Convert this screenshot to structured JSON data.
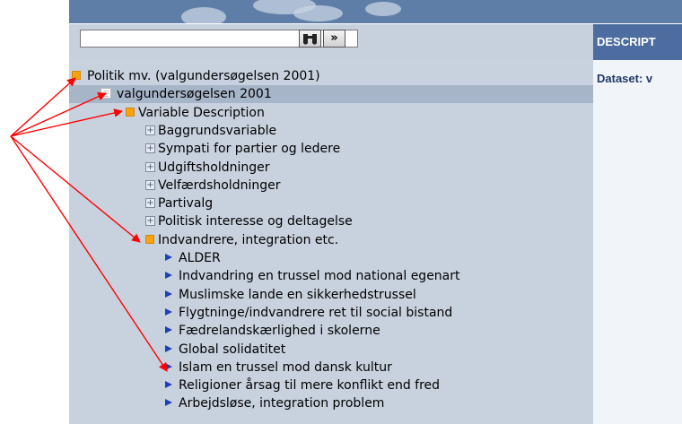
{
  "search": {
    "value": "",
    "find_icon": "binoculars-icon",
    "go_icon": "double-chevron-right-icon",
    "go_label": "»"
  },
  "description": {
    "header": "DESCRIPT",
    "dataset_label": "Dataset: v"
  },
  "tree": [
    {
      "label": "Politik mv. (valgundersøgelsen 2001)",
      "icon": "folder-icon"
    },
    {
      "label": "valgundersøgelsen 2001",
      "icon": "dataset-icon",
      "selected": true
    },
    {
      "label": "Variable Description",
      "icon": "folder-icon"
    },
    {
      "label": "Baggrundsvariable",
      "icon": "expand-plus-icon"
    },
    {
      "label": "Sympati for partier og ledere",
      "icon": "expand-plus-icon"
    },
    {
      "label": "Udgiftsholdninger",
      "icon": "expand-plus-icon"
    },
    {
      "label": "Velfærdsholdninger",
      "icon": "expand-plus-icon"
    },
    {
      "label": "Partivalg",
      "icon": "expand-plus-icon"
    },
    {
      "label": "Politisk interesse og deltagelse",
      "icon": "expand-plus-icon"
    },
    {
      "label": "Indvandrere, integration etc.",
      "icon": "folder-icon"
    },
    {
      "label": "ALDER",
      "icon": "variable-arrow-icon"
    },
    {
      "label": "Indvandring en trussel mod national egenart",
      "icon": "variable-arrow-icon"
    },
    {
      "label": "Muslimske lande en sikkerhedstrussel",
      "icon": "variable-arrow-icon"
    },
    {
      "label": "Flygtninge/indvandrere ret til social bistand",
      "icon": "variable-arrow-icon"
    },
    {
      "label": "Fædrelandskærlighed i skolerne",
      "icon": "variable-arrow-icon"
    },
    {
      "label": "Global solidatitet",
      "icon": "variable-arrow-icon"
    },
    {
      "label": "Islam en trussel mod dansk kultur",
      "icon": "variable-arrow-icon"
    },
    {
      "label": "Religioner årsag til mere konflikt end fred",
      "icon": "variable-arrow-icon"
    },
    {
      "label": "Arbejdsløse, integration problem",
      "icon": "variable-arrow-icon"
    }
  ],
  "annotation_color": "#ff0000"
}
